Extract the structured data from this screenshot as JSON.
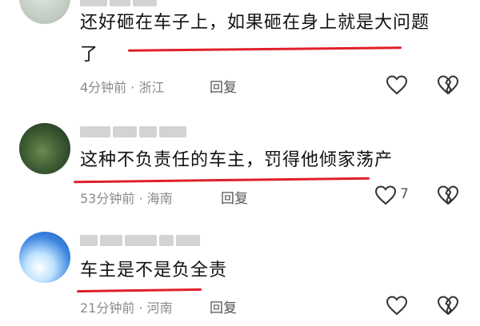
{
  "comments": [
    {
      "text_line1": "还好砸在车子上，如果砸在身上就是大问题",
      "text_line2": "了",
      "time": "4分钟前",
      "location": "浙江",
      "reply_label": "回复",
      "like_count": ""
    },
    {
      "text_line1": "这种不负责任的车主，罚得他倾家荡产",
      "time": "53分钟前",
      "location": "海南",
      "reply_label": "回复",
      "like_count": "7"
    },
    {
      "text_line1": "车主是不是负全责",
      "time": "21分钟前",
      "location": "河南",
      "reply_label": "回复",
      "like_count": ""
    }
  ],
  "meta_separator": "·",
  "colors": {
    "underline": "#e0202a",
    "meta": "#8a8a8a",
    "text": "#111111"
  },
  "icons": {
    "like": "heart-outline-icon",
    "dislike": "broken-heart-icon"
  }
}
